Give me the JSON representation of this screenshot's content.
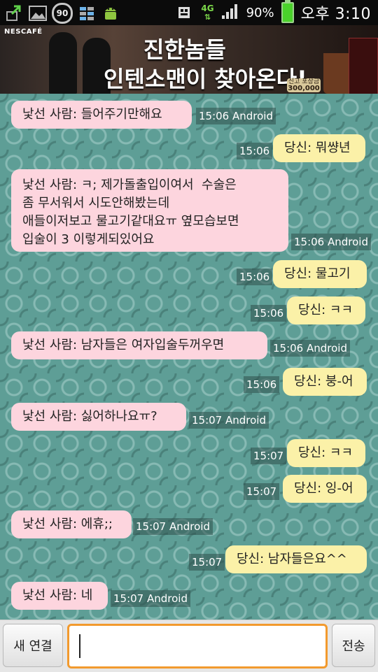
{
  "status_bar": {
    "icons": [
      "upload-icon",
      "image-icon",
      "speed-limit-90-icon",
      "grid-icon",
      "android-icon"
    ],
    "speed_sign": "90",
    "network": "4G",
    "battery": "90%",
    "time": "오후 3:10"
  },
  "ad": {
    "brand": "NESCAFÉ",
    "headline_line1": "진한놈들",
    "headline_line2": "인텐소맨이 찾아온다!",
    "badge_line1": "신고 포상금",
    "badge_line2": "300,000"
  },
  "messages": [
    {
      "sender": "stranger",
      "text": "낯선 사람: 들어주기만해요",
      "time": "15:06 Android"
    },
    {
      "sender": "you",
      "text": "당신: 뭐썅년",
      "time": "15:06"
    },
    {
      "sender": "stranger",
      "text": "낯선 사람: ㅋ; 제가돌출입이여서  수술은\n좀 무서워서 시도안해봤는데\n애들이저보고 물고기같대요ㅠ 옆모습보면\n입술이 3 이렇게되있어요",
      "time": "15:06 Android"
    },
    {
      "sender": "you",
      "text": "당신: 물고기",
      "time": "15:06"
    },
    {
      "sender": "you",
      "text": "당신: ㅋㅋ",
      "time": "15:06"
    },
    {
      "sender": "stranger",
      "text": "낯선 사람: 남자들은 여자입술두꺼우면",
      "time": "15:06 Android"
    },
    {
      "sender": "you",
      "text": "당신: 붕-어",
      "time": "15:06"
    },
    {
      "sender": "stranger",
      "text": "낯선 사람: 싫어하나요ㅠ?",
      "time": "15:07 Android"
    },
    {
      "sender": "you",
      "text": "당신: ㅋㅋ",
      "time": "15:07"
    },
    {
      "sender": "you",
      "text": "당신: 잉-어",
      "time": "15:07"
    },
    {
      "sender": "stranger",
      "text": "낯선 사람: 에휴;;",
      "time": "15:07 Android"
    },
    {
      "sender": "you",
      "text": "당신: 남자들은요^^",
      "time": "15:07"
    },
    {
      "sender": "stranger",
      "text": "낯선 사람: 네",
      "time": "15:07 Android"
    }
  ],
  "bottom": {
    "new_connection_label": "새 연결",
    "input_value": "",
    "send_label": "전송"
  },
  "colors": {
    "stranger_bubble": "#fdd5de",
    "you_bubble": "#fbf1a8",
    "input_border": "#f29a2e",
    "chat_background": "#5e9e96"
  }
}
